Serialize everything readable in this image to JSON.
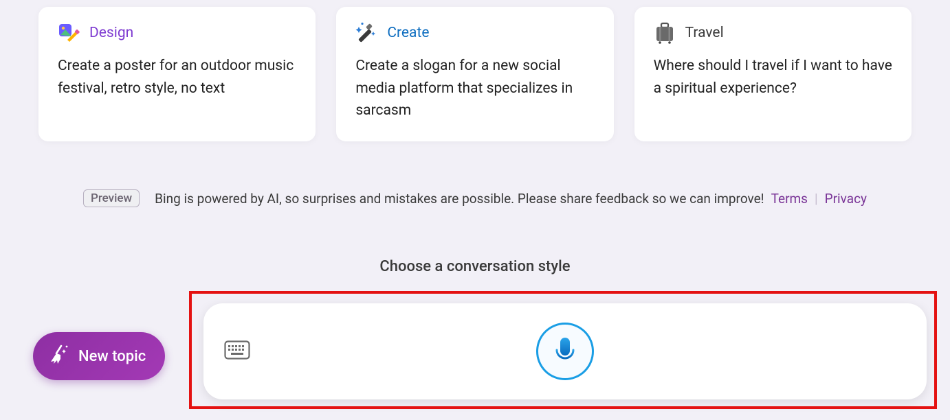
{
  "cards": [
    {
      "title": "Design",
      "body": "Create a poster for an outdoor music festival, retro style, no text"
    },
    {
      "title": "Create",
      "body": "Create a slogan for a new social media platform that specializes in sarcasm"
    },
    {
      "title": "Travel",
      "body": "Where should I travel if I want to have a spiritual experience?"
    }
  ],
  "preview_badge": "Preview",
  "disclaimer": "Bing is powered by AI, so surprises and mistakes are possible. Please share feedback so we can improve!",
  "links": {
    "terms": "Terms",
    "privacy": "Privacy"
  },
  "choose_style": "Choose a conversation style",
  "new_topic": "New topic",
  "colors": {
    "design": "#7e3bd1",
    "create": "#0b6cbf",
    "travel": "#3a3a3a",
    "accent_purple": "#8e2fa3",
    "highlight_red": "#e41212"
  }
}
